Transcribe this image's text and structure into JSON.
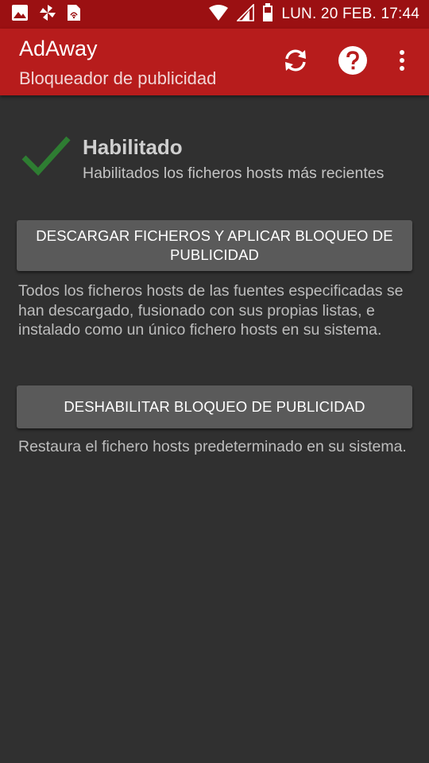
{
  "status_bar": {
    "time": "LUN. 20 FEB. 17:44",
    "left_icons": [
      "image-icon",
      "pinwheel-icon",
      "sim-card-icon"
    ],
    "right_icons": [
      "wifi-icon",
      "signal-icon",
      "battery-icon"
    ]
  },
  "app_bar": {
    "title": "AdAway",
    "subtitle": "Bloqueador de publicidad",
    "actions": [
      "refresh-icon",
      "help-icon",
      "overflow-menu-icon"
    ]
  },
  "status": {
    "title": "Habilitado",
    "description": "Habilitados los ficheros hosts más recientes",
    "icon": "check-icon",
    "icon_color": "#2e7d32"
  },
  "download_button": {
    "label": "DESCARGAR FICHEROS Y APLICAR BLOQUEO DE PUBLICIDAD",
    "description": "Todos los ficheros hosts de las fuentes especificadas se han descargado, fusionado con sus propias listas, e instalado como un único fichero hosts en su sistema."
  },
  "disable_button": {
    "label": "DESHABILITAR BLOQUEO DE PUBLICIDAD",
    "description": "Restaura el fichero hosts predeterminado en su sistema."
  },
  "colors": {
    "status_bar": "#9b1012",
    "app_bar": "#b71c1c",
    "background": "#303030",
    "button": "#5a5a5a"
  }
}
